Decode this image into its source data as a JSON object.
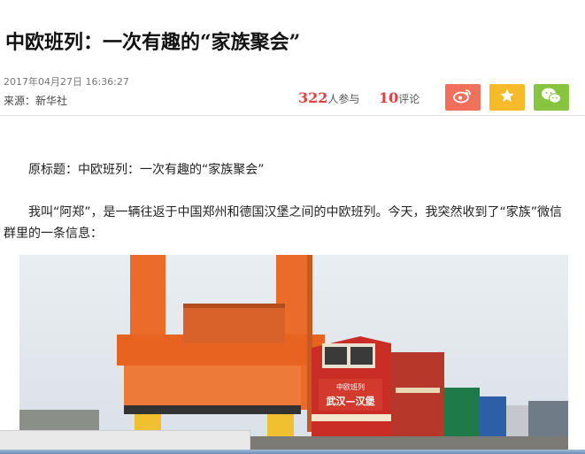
{
  "article": {
    "title": "中欧班列：一次有趣的“家族聚会”",
    "timestamp": "2017年04月27日  16:36:27",
    "source": "来源：新华社",
    "participants_count": "322",
    "participants_label": "人参与",
    "comments_count": "10",
    "comments_label": "评论",
    "paragraphs": [
      "原标题：中欧班列：一次有趣的“家族聚会”",
      "我叫“阿郑”，是一辆往返于中国郑州和德国汉堡之间的中欧班列。今天，我突然收到了“家族”微信群里的一条信息："
    ]
  },
  "share": {
    "weibo_icon": "weibo-icon",
    "favorite_icon": "star-icon",
    "wechat_icon": "wechat-icon",
    "colors": {
      "weibo": "#f26f5c",
      "favorite": "#f6ba2a",
      "wechat": "#87c440"
    }
  },
  "photo": {
    "locomotive_sign_top": "中欧班列",
    "locomotive_sign_main": "武汉—汉堡"
  },
  "colors": {
    "accent": "#e43f3f"
  }
}
